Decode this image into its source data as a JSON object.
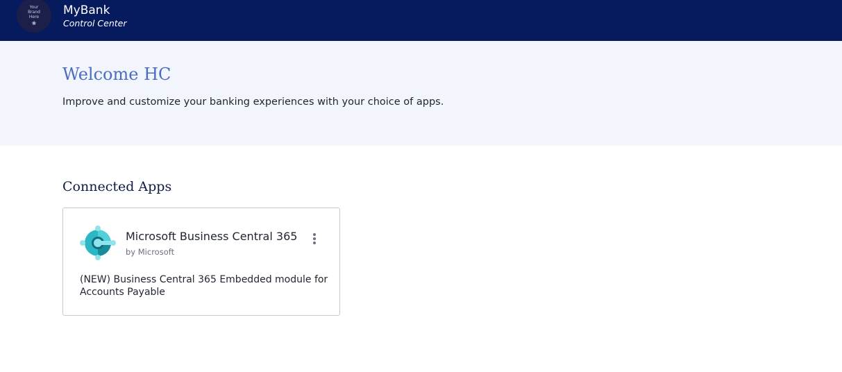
{
  "header": {
    "logo_text": "Your\nBrand\nHere",
    "title": "MyBank",
    "subtitle": "Control Center",
    "icons": {
      "logo": "brand-logo-icon"
    }
  },
  "welcome": {
    "title": "Welcome HC",
    "text": "Improve and customize your banking experiences with your choice of apps."
  },
  "connected_apps": {
    "title": "Connected Apps",
    "apps": [
      {
        "name": "Microsoft Business Central 365",
        "vendor": "by Microsoft",
        "description": "(NEW) Business Central 365 Embedded module for Accounts Payable",
        "icon": "business-central-icon",
        "menu_icon": "more-vertical-icon"
      }
    ]
  },
  "colors": {
    "header_bg": "#061a5e",
    "banner_bg": "#f2f5fc",
    "welcome_title": "#4b6cc1",
    "section_title": "#0e1b45",
    "card_border": "#c8cad0",
    "icon_teal": "#2bb8c4",
    "icon_dark_teal": "#0f6f7d"
  }
}
